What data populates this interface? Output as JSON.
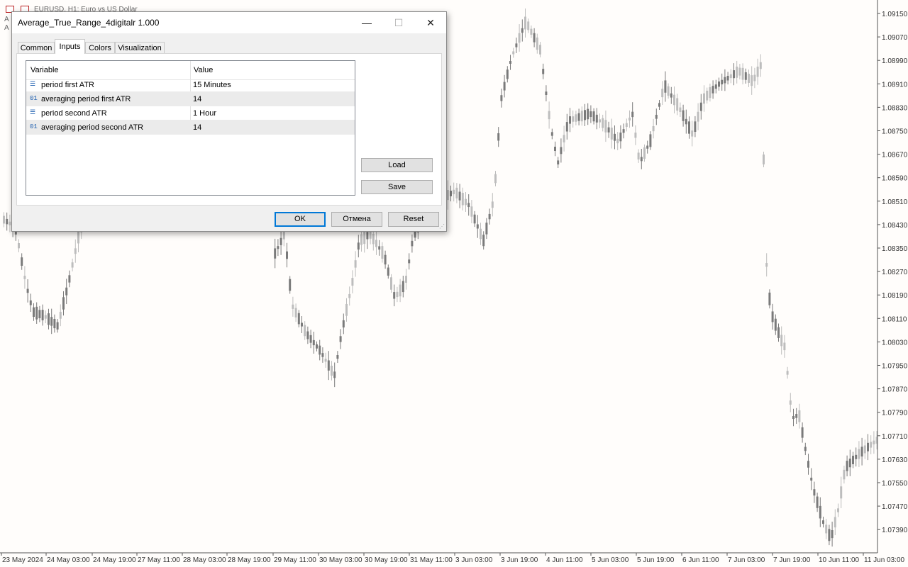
{
  "chart": {
    "title": "EURUSD, H1:  Euro vs US Dollar",
    "indicator_lines": [
      "A",
      "A"
    ],
    "y_labels": [
      "1.09150",
      "1.09070",
      "1.08990",
      "1.08910",
      "1.08830",
      "1.08750",
      "1.08670",
      "1.08590",
      "1.08510",
      "1.08430",
      "1.08350",
      "1.08270",
      "1.08190",
      "1.08110",
      "1.08030",
      "1.07950",
      "1.07870",
      "1.07790",
      "1.07710",
      "1.07630",
      "1.07550",
      "1.07470",
      "1.07390"
    ],
    "x_labels": [
      "23 May 2024",
      "24 May 03:00",
      "24 May 19:00",
      "27 May 11:00",
      "28 May 03:00",
      "28 May 19:00",
      "29 May 11:00",
      "30 May 03:00",
      "30 May 19:00",
      "31 May 11:00",
      "3 Jun 03:00",
      "3 Jun 19:00",
      "4 Jun 11:00",
      "5 Jun 03:00",
      "5 Jun 19:00",
      "6 Jun 11:00",
      "7 Jun 03:00",
      "7 Jun 19:00",
      "10 Jun 11:00",
      "11 Jun 03:00"
    ]
  },
  "dialog": {
    "title": "Average_True_Range_4digitalr 1.000",
    "minimize_symbol": "—",
    "maximize_symbol": "☐",
    "close_symbol": "✕",
    "tabs": [
      {
        "label": "Common",
        "active": false
      },
      {
        "label": "Inputs",
        "active": true
      },
      {
        "label": "Colors",
        "active": false
      },
      {
        "label": "Visualization",
        "active": false
      }
    ],
    "grid": {
      "headers": [
        "Variable",
        "Value"
      ],
      "rows": [
        {
          "icon": "enum-icon",
          "glyph": "☰",
          "variable": "period first ATR",
          "value": "15 Minutes"
        },
        {
          "icon": "number-icon",
          "glyph": "01",
          "variable": "averaging period first ATR",
          "value": "14"
        },
        {
          "icon": "enum-icon",
          "glyph": "☰",
          "variable": "period second ATR",
          "value": "1 Hour"
        },
        {
          "icon": "number-icon",
          "glyph": "01",
          "variable": "averaging period second ATR",
          "value": "14"
        }
      ]
    },
    "buttons": {
      "load": "Load",
      "save": "Save",
      "ok": "OK",
      "cancel": "Отмена",
      "reset": "Reset"
    }
  },
  "colors": {
    "candle_up": "#bdbdbd",
    "candle_down": "#7a7a7a",
    "ok_border": "#0078d7"
  }
}
